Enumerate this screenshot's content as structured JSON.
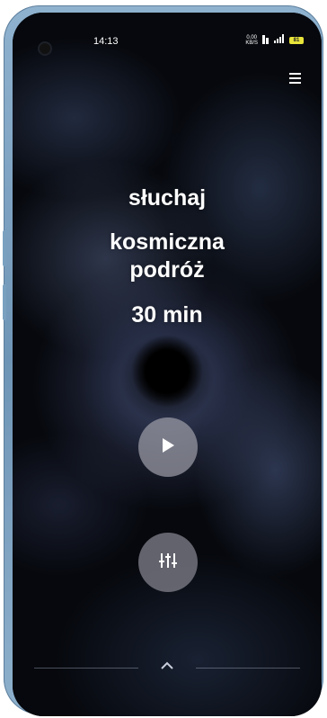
{
  "status_bar": {
    "time": "14:13",
    "net_speed_value": "0.00",
    "net_speed_unit": "KB/S",
    "battery_level": "81",
    "icons": [
      "network-speed-icon",
      "volte-icon",
      "signal-icon",
      "battery-icon"
    ]
  },
  "header": {
    "menu_icon": "hamburger-menu-icon"
  },
  "session": {
    "label": "słuchaj",
    "title_line1": "kosmiczna",
    "title_line2": "podróż",
    "duration": "30 min"
  },
  "controls": {
    "play_icon": "play-icon",
    "mixer_icon": "mixer-sliders-icon",
    "expand_icon": "chevron-up-icon"
  },
  "colors": {
    "text": "#ffffff",
    "button_bg": "#a0a0aa",
    "battery": "#e8e43a",
    "background": "#06080d"
  }
}
